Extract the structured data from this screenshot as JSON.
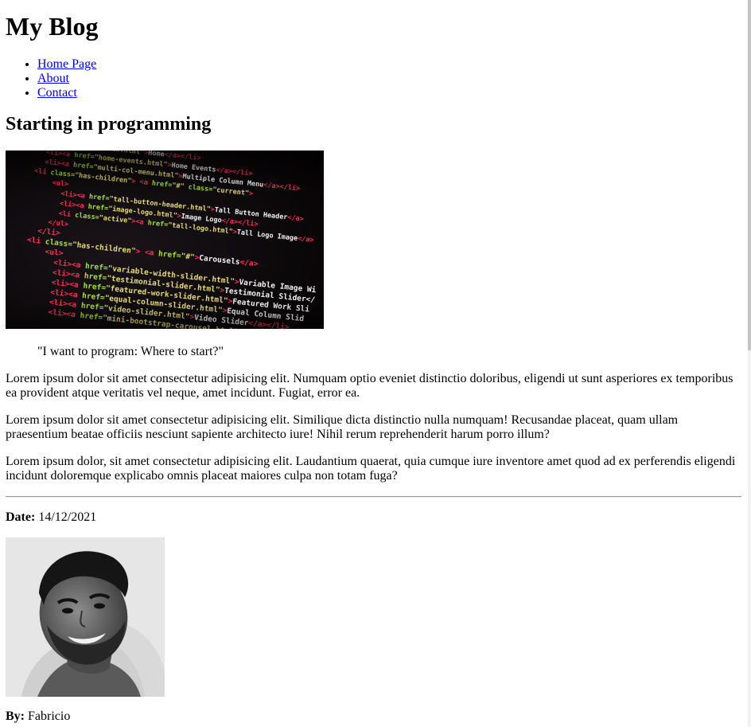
{
  "site": {
    "title": "My Blog"
  },
  "nav": {
    "items": [
      {
        "label": "Home Page"
      },
      {
        "label": "About"
      },
      {
        "label": "Contact"
      }
    ]
  },
  "post": {
    "title": "Starting in programming",
    "quote": "\"I want to program: Where to start?\"",
    "paragraphs": [
      "Lorem ipsum dolor sit amet consectetur adipisicing elit. Numquam optio eveniet distinctio doloribus, eligendi ut sunt asperiores ex temporibus ea provident atque veritatis vel neque, amet incidunt. Fugiat, error ea.",
      "Lorem ipsum dolor sit amet consectetur adipisicing elit. Similique dicta distinctio nulla numquam! Recusandae placeat, quam ullam praesentium beatae officiis nesciunt sapiente architecto iure! Nihil rerum reprehenderit harum porro illum?",
      "Lorem ipsum dolor, sit amet consectetur adipisicing elit. Laudantium quaerat, quia cumque iure inventore amet quod ad ex perferendis eligendi incidunt doloremque explicabo omnis placeat maiores culpa non totam fuga?"
    ],
    "date_label": "Date:",
    "date_value": " 14/12/2021",
    "author_label": "By:",
    "author_value": " Fabricio"
  },
  "hero_image": {
    "code_lines": [
      "<li><a href=\"index.html\">Home</a></li>",
      "<li><a href=\"home-events.html\">Home Events</a></li>",
      "<li><a href=\"multi-col-menu.html\">Multiple Column Menu</a></li>",
      "<li class=\"has-children\"> <a href=\"#\" class=\"current\">",
      "<ul>",
      "<li><a href=\"tall-button-header.html\">Tall Button Header</a>",
      "<li><a href=\"image-logo.html\">Image Logo</a></li>",
      "<li class=\"active\"><a href=\"tall-logo.html\">Tall Logo Image</a>",
      "</ul>",
      "</li>",
      "<li class=\"has-children\"> <a href=\"#\">Carousels</a>",
      "<ul>",
      "<li><a href=\"variable-width-slider.html\">Variable Image Wi",
      "<li><a href=\"testimonial-slider.html\">Testimonial Slider</",
      "<li><a href=\"featured-work-slider.html\">Featured Work Sli",
      "<li><a href=\"equal-column-slider.html\">Equal Column Slid",
      "<li><a href=\"video-slider.html\">Video Slider</a></li>",
      "<li><a href=\"mini-bootstrap-carousel.html\">Mini Slider</"
    ]
  }
}
